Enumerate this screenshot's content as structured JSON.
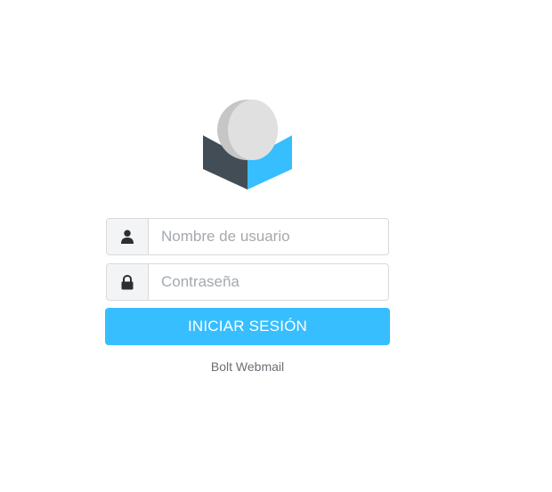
{
  "login": {
    "username_placeholder": "Nombre de usuario",
    "password_placeholder": "Contraseña",
    "submit_label": "INICIAR SESIÓN",
    "product_name": "Bolt Webmail"
  },
  "icons": {
    "logo": "roundcube-logo",
    "username": "user-icon",
    "password": "lock-icon"
  },
  "colors": {
    "accent": "#37beff",
    "logo_dark": "#424d55",
    "logo_blue": "#37beff",
    "logo_sphere": "#e0e0e0",
    "logo_sphere_shadow": "#c6c6c6",
    "addon_bg": "#f3f4f5",
    "footer_text": "#6a6f75"
  }
}
